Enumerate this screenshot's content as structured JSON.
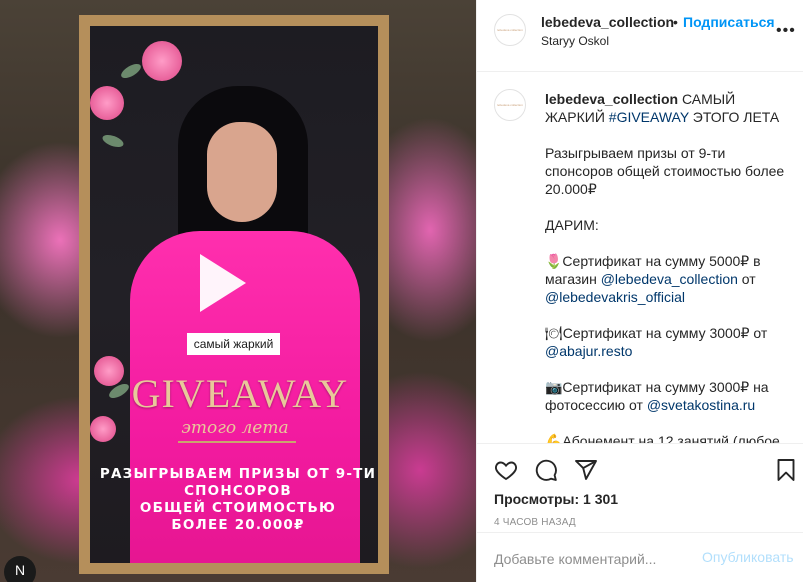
{
  "media": {
    "tag": "самый жаркий",
    "title": "GIVEAWAY",
    "subtitle": "этого лета",
    "headline": "РАЗЫГРЫВАЕМ ПРИЗЫ ОТ 9-ТИ\nСПОНСОРОВ\nОБЩЕЙ СТОИМОСТЬЮ\nБОЛЕЕ 20.000₽",
    "corner_avatar": "N"
  },
  "header": {
    "username": "lebedeva_collection",
    "separator": "•",
    "follow_label": "Подписаться",
    "location": "Staryy Oskol",
    "more": "•••",
    "avatar_text": "lebedeva collection"
  },
  "caption": {
    "username": "lebedeva_collection",
    "text_1": " САМЫЙ ЖАРКИЙ ",
    "hashtag": "#GIVEAWAY",
    "text_2": " ЭТОГО ЛЕТА",
    "para_1": "Разыгрываем призы от 9-ти спонсоров общей стоимостью более 20.000₽",
    "para_2": "ДАРИМ:",
    "p3_a": "🌷Сертификат на сумму 5000₽ в магазин ",
    "p3_m1": "@lebedeva_collection",
    "p3_b": " от ",
    "p3_m2": "@lebedevakris_official",
    "p4_a": "🍽Сертификат на сумму 3000₽ от ",
    "p4_m": "@abajur.resto",
    "p5_a": "📷Сертификат на сумму 3000₽ на фотосессию от ",
    "p5_m": "@svetakostina.ru",
    "p6": "💪Абонемент на 12 занятий (любое"
  },
  "stats": {
    "views": "Просмотры: 1 301",
    "time": "4 ЧАСОВ НАЗАД"
  },
  "comment_box": {
    "placeholder": "Добавьте комментарий...",
    "publish_label": "Опубликовать"
  },
  "colors": {
    "accent": "#0095f6",
    "publish_disabled": "#b2dffc",
    "link": "#00376b",
    "suit_pink": "#f21a9f",
    "frame_gold": "#b58f5b"
  }
}
